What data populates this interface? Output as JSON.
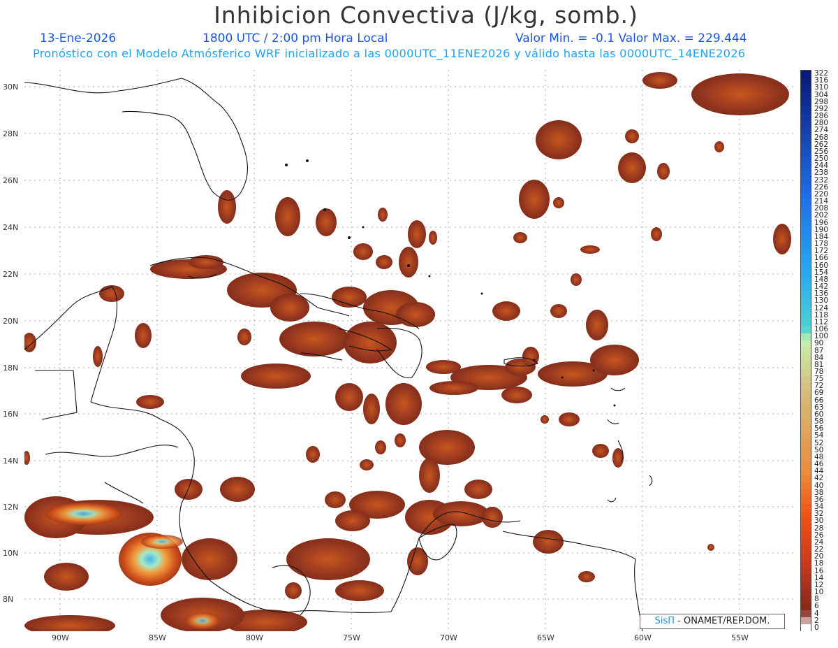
{
  "header": {
    "title": "Inhibicion Convectiva (J/kg, somb.)",
    "date": "13-Ene-2026",
    "time": "1800 UTC / 2:00 pm Hora Local",
    "minmax": "Valor Min. = -0.1  Valor Max. = 229.444",
    "subtitle": "Pronóstico con el Modelo Atmósferico WRF inicializado a las 0000UTC_11ENE2026 y válido hasta las  0000UTC_14ENE2026"
  },
  "axes": {
    "lat_labels": [
      "30N",
      "28N",
      "26N",
      "24N",
      "22N",
      "20N",
      "18N",
      "16N",
      "14N",
      "12N",
      "10N",
      "8N"
    ],
    "lon_labels": [
      "90W",
      "85W",
      "80W",
      "75W",
      "70W",
      "65W",
      "60W",
      "55W"
    ]
  },
  "colorbar": {
    "labels": [
      "322",
      "316",
      "310",
      "304",
      "298",
      "292",
      "286",
      "280",
      "274",
      "268",
      "262",
      "256",
      "250",
      "244",
      "238",
      "232",
      "226",
      "220",
      "214",
      "208",
      "202",
      "196",
      "190",
      "184",
      "178",
      "172",
      "166",
      "160",
      "154",
      "148",
      "142",
      "136",
      "130",
      "124",
      "118",
      "112",
      "106",
      "100",
      "90",
      "87",
      "84",
      "81",
      "78",
      "75",
      "72",
      "69",
      "66",
      "63",
      "60",
      "58",
      "56",
      "54",
      "52",
      "50",
      "48",
      "46",
      "44",
      "42",
      "40",
      "38",
      "36",
      "34",
      "32",
      "30",
      "28",
      "26",
      "24",
      "22",
      "20",
      "18",
      "16",
      "14",
      "12",
      "10",
      "8",
      "6",
      "4",
      "2",
      "0"
    ],
    "colors": {
      "high": "#0a1a78",
      "mid": "#1f8ef0",
      "cyan": "#40d0d0",
      "green": "#b8e890",
      "tan": "#d8b070",
      "orange": "#f06010",
      "brown": "#8a2a1a",
      "zero": "#ffffff"
    }
  },
  "credit": {
    "brand": "SisΠ",
    "text": " - ONAMET/REP.DOM."
  },
  "legend_colors": {
    "field": "#8b3a22",
    "field_inner": "#c04a1c",
    "hot": "#60d0e8"
  }
}
